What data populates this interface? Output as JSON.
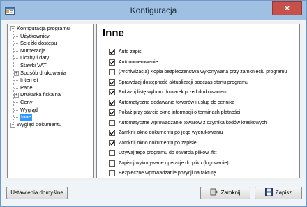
{
  "window": {
    "title": "Konfiguracja",
    "close_glyph": "✕"
  },
  "tree": {
    "items": [
      {
        "label": "Konfiguracja programu",
        "level": 0,
        "expander": "−"
      },
      {
        "label": "Użytkownicy",
        "level": 1,
        "expander": ""
      },
      {
        "label": "Ścieżki dostępu",
        "level": 1,
        "expander": ""
      },
      {
        "label": "Numeracja",
        "level": 1,
        "expander": ""
      },
      {
        "label": "Liczby i daty",
        "level": 1,
        "expander": ""
      },
      {
        "label": "Stawki VAT",
        "level": 1,
        "expander": ""
      },
      {
        "label": "Sposób drukowania",
        "level": 1,
        "expander": "+"
      },
      {
        "label": "Internet",
        "level": 1,
        "expander": ""
      },
      {
        "label": "Panel",
        "level": 1,
        "expander": ""
      },
      {
        "label": "Drukarka fiskalna",
        "level": 1,
        "expander": "+"
      },
      {
        "label": "Ceny",
        "level": 1,
        "expander": ""
      },
      {
        "label": "Wygląd",
        "level": 1,
        "expander": ""
      },
      {
        "label": "Inne",
        "level": 1,
        "expander": "",
        "selected": true
      },
      {
        "label": "Wygląd dokumentu",
        "level": 0,
        "expander": "+"
      }
    ]
  },
  "panel": {
    "title": "Inne",
    "options": [
      {
        "label": "Auto zapis",
        "checked": true
      },
      {
        "label": "Autonumerowanie",
        "checked": true
      },
      {
        "label": "(Archiwizacja) Kopia bezpieczeństwa wykonywana przy zamknięciu programu",
        "checked": false
      },
      {
        "label": "Sprawdzaj dostępność aktualizacji podczas startu programu",
        "checked": true
      },
      {
        "label": "Pokazuj listę wyboru drukarek przed drukowaniem",
        "checked": true
      },
      {
        "label": "Automatyczne dodawanie towarów i usług do cennika",
        "checked": true
      },
      {
        "label": "Pokaż przy starcie okno informacji o terminach płatności",
        "checked": true
      },
      {
        "label": "Automatyczne wprowadzanie towarów z czytnika kodów kreskowych",
        "checked": false
      },
      {
        "label": "Zamknij okno dokumentu po jego wydrukowaniu",
        "checked": true
      },
      {
        "label": "Zamknij okno dokumentu po zapisie",
        "checked": true
      },
      {
        "label": "Używaj tego programu do otwarcia plików .fkt",
        "checked": false
      },
      {
        "label": "Zapisuj wykonywane operacje do pliku (logowanie)",
        "checked": false
      },
      {
        "label": "Bezpieczne wprowadzanie pozycji na fakturę",
        "checked": false
      }
    ]
  },
  "buttons": {
    "defaults": "Ustawienia domyślne",
    "close": "Zamknij",
    "save": "Zapisz"
  },
  "colors": {
    "selection": "#3399ff",
    "close_button": "#c7504b",
    "titlebar": "#9fc0e3"
  }
}
